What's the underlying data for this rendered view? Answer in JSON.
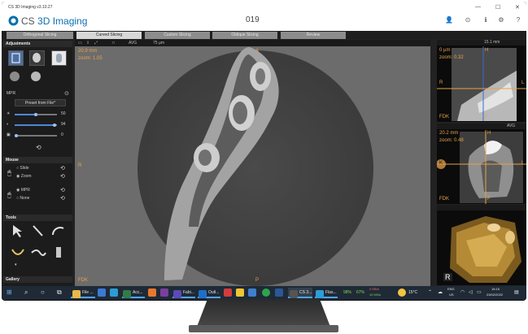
{
  "window": {
    "small_title": "CS 3D Imaging v3.10.27",
    "brand_prefix": "CS ",
    "brand_name": "3D Imaging",
    "patient_id": "019",
    "controls": [
      "—",
      "☐",
      "✕"
    ]
  },
  "tabs": [
    {
      "label": "Orthogonal Slicing",
      "active": false
    },
    {
      "label": "Curved Slicing",
      "active": true
    },
    {
      "label": "Custom Slicing",
      "active": false
    },
    {
      "label": "Oblique Slicing",
      "active": false
    },
    {
      "label": "Review",
      "active": false
    }
  ],
  "left_panel": {
    "adjustments_title": "Adjustments",
    "mpr_label": "MPR",
    "preset_value": "Preset from File*",
    "brightness_value": "50",
    "contrast_value": "94",
    "gamma_value": "0",
    "mouse_title": "Mouse",
    "mouse_options": [
      {
        "label": "Slide",
        "checked": false
      },
      {
        "label": "Zoom",
        "checked": true
      },
      {
        "label": "MPR",
        "checked": true
      },
      {
        "label": "None",
        "checked": false
      }
    ],
    "tools_title": "Tools",
    "gallery_title": "Gallery"
  },
  "main_view": {
    "toolbar_icons": [
      "screen-icon",
      "export-icon",
      "fit-icon",
      "x4-icon"
    ],
    "toolbar_zoom_text": "AVG",
    "toolbar_size_text": "75 µm",
    "thickness": "20.9 mm",
    "zoom": "zoom: 1.05",
    "orientation_top": "A",
    "orientation_left": "R",
    "orientation_bottom": "P",
    "modality": "FDK"
  },
  "right_top_view": {
    "thickness": "0 µm",
    "zoom": "zoom: 0.32",
    "label_left": "R",
    "label_right": "L",
    "label_top": "H",
    "label_bottom": "F",
    "modality": "FDK",
    "toolbar_text": "15.1 mm"
  },
  "right_mid_view": {
    "thickness": "20.2 mm",
    "zoom": "zoom: 0.48",
    "label_left": "K",
    "label_right": "L",
    "label_top": "H",
    "label_bottom": "F",
    "modality": "FDK",
    "toolbar_text": "AVG"
  },
  "right_bottom_view": {
    "badge": "R"
  },
  "taskbar": {
    "items": [
      {
        "label": "File ...",
        "color": "#e8b84a"
      },
      {
        "label": "Acc...",
        "color": "#2f7d4a"
      },
      {
        "label": "Fabi...",
        "color": "#7a3f9e"
      },
      {
        "label": "Outl...",
        "color": "#1f6fc9"
      },
      {
        "label": "CS 3...",
        "color": "#555555"
      },
      {
        "label": "Flas...",
        "color": "#2b9ed8"
      }
    ],
    "cpu": "98%",
    "ram": "67%",
    "net_up": "0 KB/s",
    "net_down": "10 KB/s",
    "weather": "15°C",
    "lang": "ENG",
    "region": "US",
    "time": "16:16",
    "date": "23/02/2022"
  }
}
